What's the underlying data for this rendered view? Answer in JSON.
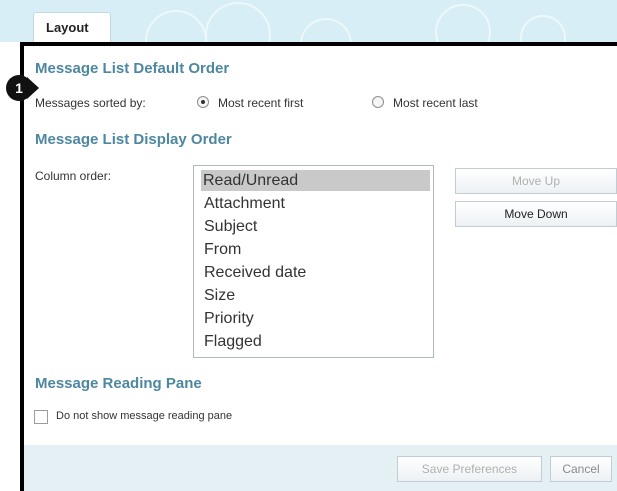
{
  "tabs": [
    {
      "label": "Layout"
    }
  ],
  "annotation": {
    "number": "1"
  },
  "sort_section": {
    "title": "Message List Default Order",
    "label": "Messages sorted by:",
    "options": [
      {
        "label": "Most recent first",
        "checked": true
      },
      {
        "label": "Most recent last",
        "checked": false
      }
    ]
  },
  "display_section": {
    "title": "Message List Display Order",
    "column_label": "Column order:",
    "columns": [
      "Read/Unread",
      "Attachment",
      "Subject",
      "From",
      "Received date",
      "Size",
      "Priority",
      "Flagged"
    ],
    "selected": "Read/Unread",
    "move_up_label": "Move Up",
    "move_down_label": "Move Down"
  },
  "reading_section": {
    "title": "Message Reading Pane",
    "checkbox_label": "Do not show message reading pane",
    "checked": false
  },
  "footer": {
    "save_label": "Save Preferences",
    "cancel_label": "Cancel"
  }
}
